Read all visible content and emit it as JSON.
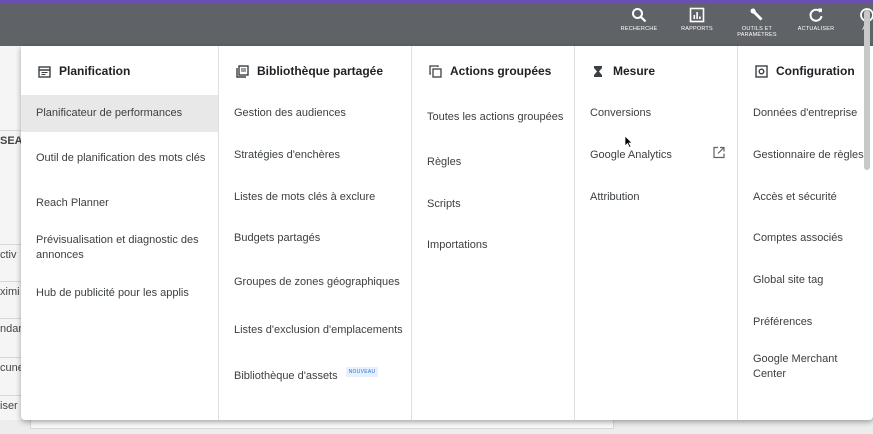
{
  "toolbar": {
    "search": "RECHERCHE",
    "reports": "RAPPORTS",
    "tools_line1": "OUTILS ET",
    "tools_line2": "PARAMÈTRES",
    "refresh": "ACTUALISER",
    "help": "AI"
  },
  "background_fragments": [
    "SEAR",
    "ctiv",
    "ximi",
    "ndar",
    "cune",
    "iser"
  ],
  "columns": {
    "planning": {
      "title": "Planification",
      "items": [
        "Planificateur de performances",
        "Outil de planification des mots clés",
        "Reach Planner",
        "Prévisualisation et diagnostic des annonces",
        "Hub de publicité pour les applis"
      ]
    },
    "shared_library": {
      "title": "Bibliothèque partagée",
      "items": [
        "Gestion des audiences",
        "Stratégies d'enchères",
        "Listes de mots clés à exclure",
        "Budgets partagés",
        "Groupes de zones géographiques",
        "Listes d'exclusion d'emplacements",
        "Bibliothèque d'assets"
      ],
      "new_badge": "NOUVEAU"
    },
    "bulk_actions": {
      "title": "Actions groupées",
      "items": [
        "Toutes les actions groupées",
        "Règles",
        "Scripts",
        "Importations"
      ]
    },
    "measurement": {
      "title": "Mesure",
      "items": [
        "Conversions",
        "Google Analytics",
        "Attribution"
      ]
    },
    "setup": {
      "title": "Configuration",
      "items": [
        "Données d'entreprise",
        "Gestionnaire de règles",
        "Accès et sécurité",
        "Comptes associés",
        "Global site tag",
        "Préférences",
        "Google Merchant Center"
      ]
    }
  },
  "colors": {
    "topbar": "#5f6368",
    "accent_line": "#6a4fb0",
    "link_blue": "#1a73e8"
  }
}
